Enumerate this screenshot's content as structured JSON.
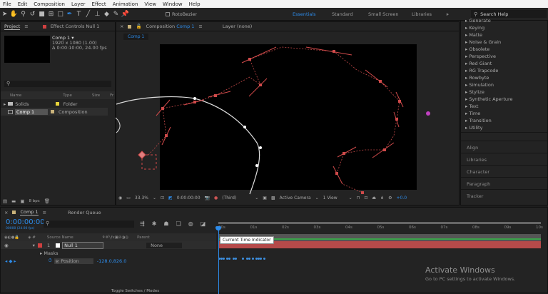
{
  "menu": [
    "File",
    "Edit",
    "Composition",
    "Layer",
    "Effect",
    "Animation",
    "View",
    "Window",
    "Help"
  ],
  "toolbar": {
    "rotobezier": "RotoBezier",
    "workspaces": [
      "Essentials",
      "Standard",
      "Small Screen",
      "Libraries"
    ],
    "active_workspace": "Essentials",
    "more": "»",
    "search_placeholder": "Search Help"
  },
  "project": {
    "tab": "Project",
    "effect_controls_tab": "Effect Controls Null 1",
    "comp_name": "Comp 1 ▾",
    "comp_size": "1920 x 1080 (1.00)",
    "comp_duration": "Δ 0:00:10:00, 24.00 fps",
    "columns": {
      "name": "Name",
      "type": "Type",
      "size": "Size",
      "fr": "Fr"
    },
    "items": [
      {
        "name": "Solids",
        "type": "Folder",
        "label_color": "#e8d33a"
      },
      {
        "name": "Comp 1",
        "type": "Composition",
        "label_color": "#c9b27a"
      }
    ],
    "bpc": "8 bpc"
  },
  "composition": {
    "tab_prefix": "Composition",
    "tab_comp": "Comp 1",
    "layer_tab": "Layer (none)",
    "breadcrumb": "Comp 1",
    "zoom": "33.3%",
    "time": "0:00:00:00",
    "resolution": "(Third)",
    "camera": "Active Camera",
    "views": "1 View",
    "exposure": "+0.0"
  },
  "effects_list": [
    "Generate",
    "Keying",
    "Matte",
    "Noise & Grain",
    "Obsolete",
    "Perspective",
    "Red Giant",
    "RG Trapcode",
    "Rowbyte",
    "Simulation",
    "Stylize",
    "Synthetic Aperture",
    "Text",
    "Time",
    "Transition",
    "Utility"
  ],
  "side_panels": [
    "Align",
    "Libraries",
    "Character",
    "Paragraph",
    "Tracker"
  ],
  "timeline": {
    "tab": "Comp 1",
    "render_queue": "Render Queue",
    "timecode": "0:00:00:00",
    "frames": "00000 (24.00 fps)",
    "columns": {
      "source_name": "Source Name",
      "parent": "Parent"
    },
    "layer": {
      "number": "1",
      "name": "Null 1",
      "parent": "None"
    },
    "masks": "Masks",
    "property": "Position",
    "property_value": "-128.0,826.0",
    "ruler": [
      "00s",
      "01s",
      "02s",
      "03s",
      "04s",
      "05s",
      "06s",
      "07s",
      "08s",
      "09s",
      "10s"
    ],
    "tooltip": "Current Time Indicator",
    "toggle": "Toggle Switches / Modes",
    "accent": "#2d8ceb",
    "layer_bar_color": "#b54a4a"
  },
  "watermark": {
    "title": "Activate Windows",
    "subtitle": "Go to PC settings to activate Windows."
  }
}
